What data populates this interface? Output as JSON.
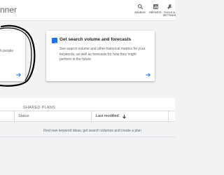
{
  "header": {
    "title_fragment": "nner",
    "tools": [
      {
        "label": "SEARCH",
        "icon": "search-icon"
      },
      {
        "label": "REPORTS",
        "icon": "reports-icon"
      },
      {
        "label": "TOOLS & SETTINGS",
        "icon": "wrench-icon"
      }
    ]
  },
  "cards": [
    {
      "text_lines": [
        "h people"
      ],
      "icon": "arrow-right-icon"
    },
    {
      "title": "Get search volume and forecasts",
      "description": "See search volume and other historical metrics for your keywords, as well as forecasts for how they might perform in the future",
      "icon": "arrow-right-icon"
    }
  ],
  "tabs": {
    "shared_plans": "SHARED PLANS"
  },
  "table": {
    "columns": [
      "Status",
      "Last modified"
    ],
    "empty_message": "Find new keyword ideas, get search volumes and create a plan"
  },
  "colors": {
    "accent": "#1a73e8",
    "background": "#f1f3f4",
    "annotation": "#000000"
  }
}
